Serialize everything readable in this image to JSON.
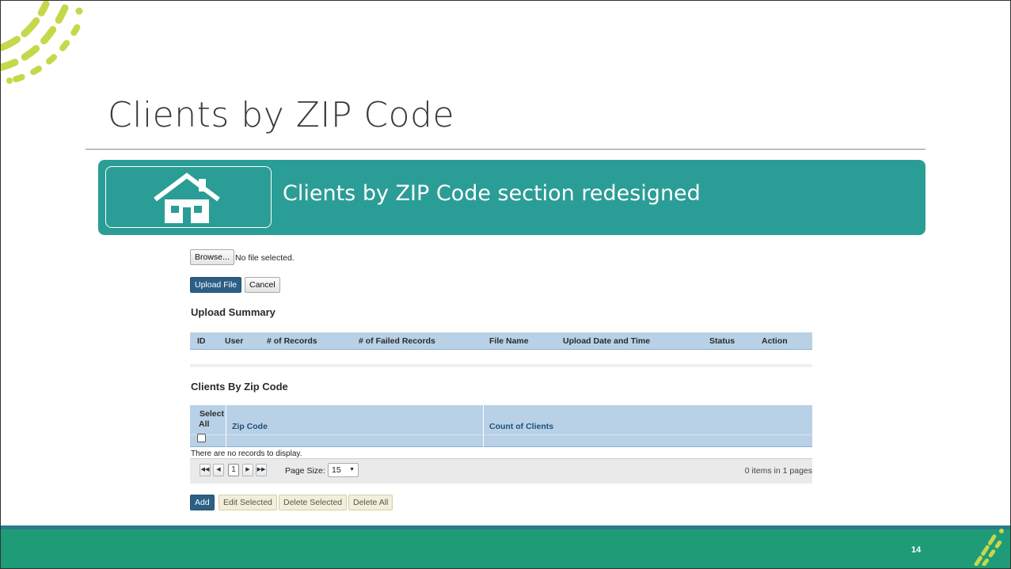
{
  "slide": {
    "title": "Clients by ZIP Code",
    "banner_text": "Clients by ZIP Code section redesigned",
    "page_number": "14",
    "banner_icon": "house-icon"
  },
  "upload": {
    "browse_label": "Browse...",
    "file_status": "No file selected.",
    "upload_label": "Upload File",
    "cancel_label": "Cancel"
  },
  "upload_summary": {
    "heading": "Upload Summary",
    "columns": [
      "ID",
      "User",
      "# of Records",
      "# of Failed Records",
      "File Name",
      "Upload Date and Time",
      "Status",
      "Action"
    ]
  },
  "clients_grid": {
    "heading": "Clients By Zip Code",
    "select_all_line1": "Select",
    "select_all_line2": "All",
    "col_zip": "Zip Code",
    "col_count": "Count of Clients",
    "empty_message": "There are no records to display.",
    "pager": {
      "current_page": "1",
      "page_size_label": "Page Size:",
      "page_size_value": "15",
      "items_info": "0 items in 1 pages"
    },
    "actions": {
      "add": "Add",
      "edit_selected": "Edit Selected",
      "delete_selected": "Delete Selected",
      "delete_all": "Delete All"
    }
  },
  "colors": {
    "banner": "#2a9d96",
    "footer": "#1f9b78",
    "grid_header": "#b8d1e6",
    "primary_button": "#2c5f85",
    "decoration": "#c6d84a"
  }
}
